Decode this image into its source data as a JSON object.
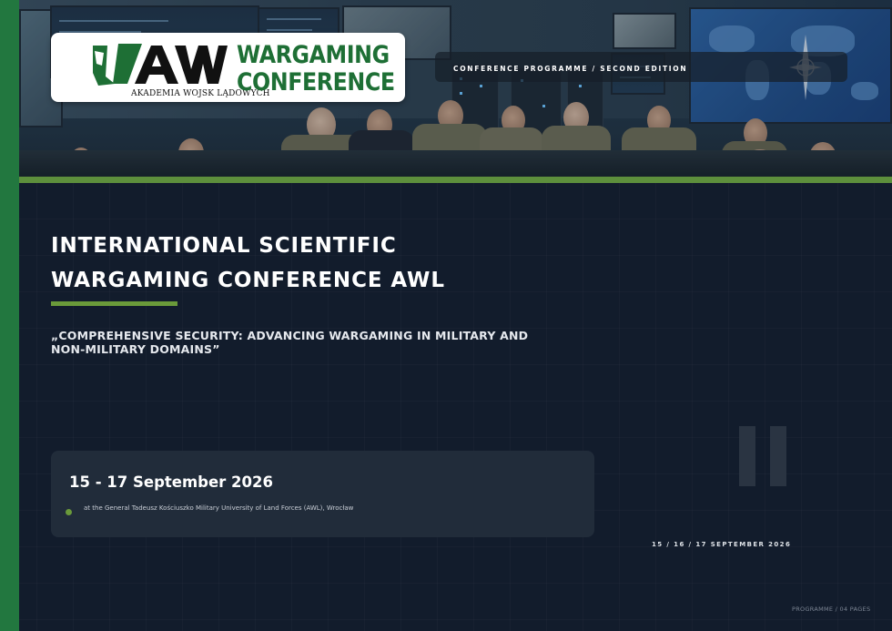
{
  "logo": {
    "mark_text": "AWL",
    "academy": "AKADEMIA WOJSK LĄDOWYCH",
    "title_line1": "WARGAMING",
    "title_line2": "CONFERENCE"
  },
  "header": {
    "programme_label": "CONFERENCE PROGRAMME / SECOND EDITION"
  },
  "main": {
    "title_line1": "INTERNATIONAL SCIENTIFIC",
    "title_line2": "WARGAMING CONFERENCE AWL",
    "subtitle": "„COMPREHENSIVE SECURITY: ADVANCING WARGAMING IN MILITARY AND NON-MILITARY DOMAINS”"
  },
  "event": {
    "dates": "15 - 17 September 2026",
    "venue": "at the General Tadeusz Kościuszko Military University of Land Forces (AWL), Wrocław",
    "dates_small": "15 / 16 / 17 SEPTEMBER 2026"
  },
  "footer": {
    "pages": "PROGRAMME / 04 PAGES"
  },
  "colors": {
    "background": "#121c2c",
    "side_bar": "#22773f",
    "accent_green": "#5d8f3c",
    "logo_green": "#1e6f35",
    "card": "#212c3a"
  },
  "icons": {
    "logo": "awl-logo-icon",
    "compass": "nato-compass-icon",
    "venue_bullet": "bullet-dot-icon",
    "roman_numeral": "roman-two-icon"
  }
}
